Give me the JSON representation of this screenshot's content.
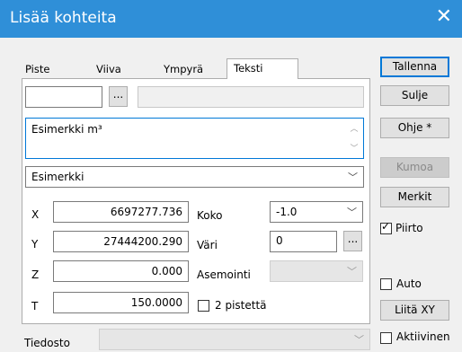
{
  "window": {
    "title": "Lisää kohteita"
  },
  "tabs": [
    {
      "label": "Piste"
    },
    {
      "label": "Viiva"
    },
    {
      "label": "Ympyrä"
    },
    {
      "label": "Teksti"
    }
  ],
  "code_row": {
    "code_value": "",
    "browse_label": "...",
    "desc_value": ""
  },
  "text_area": {
    "value": "Esimerkki m³"
  },
  "style_combo": {
    "value": "Esimerkki"
  },
  "coords": {
    "x_label": "X",
    "x_value": "6697277.736",
    "y_label": "Y",
    "y_value": "27444200.290",
    "z_label": "Z",
    "z_value": "0.000",
    "t_label": "T",
    "t_value": "150.0000"
  },
  "props": {
    "koko_label": "Koko",
    "koko_value": "-1.0",
    "vari_label": "Väri",
    "vari_value": "0",
    "vari_browse": "...",
    "asemointi_label": "Asemointi",
    "asemointi_value": "",
    "two_points_label": "2 pistettä",
    "two_points_checked": false
  },
  "bottom": {
    "tiedosto_label": "Tiedosto",
    "tiedosto_value": ""
  },
  "buttons": {
    "tallenna": "Tallenna",
    "sulje": "Sulje",
    "ohje": "Ohje *",
    "kumoa": "Kumoa",
    "merkit": "Merkit",
    "liita_xy": "Liitä XY"
  },
  "checks": {
    "piirto_label": "Piirto",
    "piirto_checked": true,
    "auto_label": "Auto",
    "auto_checked": false,
    "aktiivinen_label": "Aktiivinen",
    "aktiivinen_checked": false
  },
  "icons": {
    "close": "close-icon",
    "check": "checkmark-icon",
    "dropdown": "chevron-down-icon",
    "scroll_up": "chevron-up-icon",
    "scroll_down": "chevron-down-icon"
  }
}
